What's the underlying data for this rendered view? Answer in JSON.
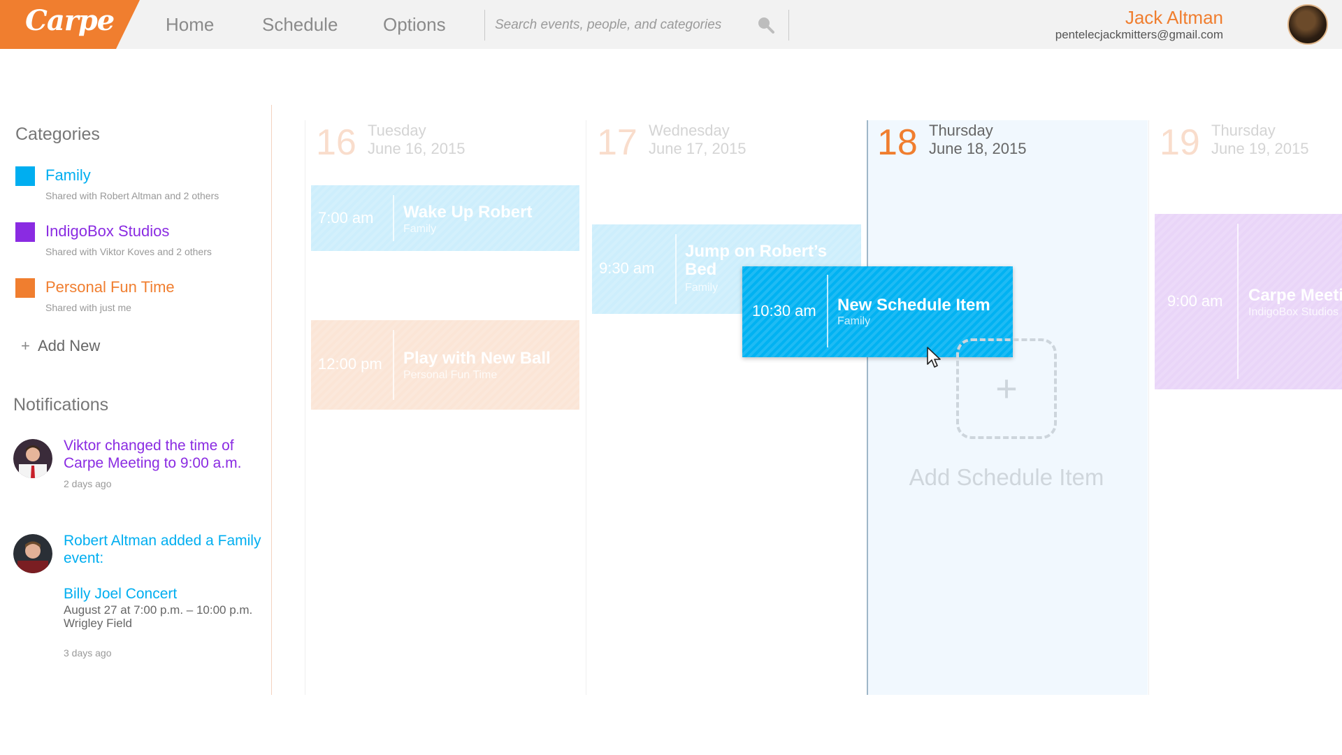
{
  "app": {
    "logo_text": "Carpe",
    "nav": [
      "Home",
      "Schedule",
      "Options"
    ],
    "search_placeholder": "Search events, people, and categories",
    "search_value": "",
    "user": {
      "name": "Jack Altman",
      "email": "pentelecjackmitters@gmail.com"
    }
  },
  "sidebar": {
    "categories_title": "Categories",
    "categories": [
      {
        "name": "Family",
        "shared": "Shared with Robert Altman and 2 others",
        "color": "#00aef0"
      },
      {
        "name": "IndigoBox Studios",
        "shared": "Shared with Viktor Koves and 2 others",
        "color": "#8a2be2"
      },
      {
        "name": "Personal Fun Time",
        "shared": "Shared with just me",
        "color": "#f07e2f"
      }
    ],
    "add_new_icon": "+",
    "add_new_label": "Add New",
    "notifications_title": "Notifications",
    "notifications": [
      {
        "text": "Viktor changed the time of Carpe Meeting to 9:00 a.m.",
        "time": "2 days ago",
        "color": "#8a2be2"
      },
      {
        "text": "Robert Altman added a Family event:",
        "event_title": "Billy Joel Concert",
        "event_when": "August 27 at 7:00 p.m. – 10:00 p.m.",
        "event_where": "Wrigley Field",
        "time": "3 days ago",
        "color": "#00aef0"
      }
    ]
  },
  "calendar": {
    "days": [
      {
        "num": "16",
        "name": "Tuesday",
        "date": "June 16, 2015"
      },
      {
        "num": "17",
        "name": "Wednesday",
        "date": "June 17, 2015"
      },
      {
        "num": "18",
        "name": "Thursday",
        "date": "June 18, 2015"
      },
      {
        "num": "19",
        "name": "Thursday",
        "date": "June 19, 2015"
      }
    ],
    "events": [
      {
        "time": "7:00 am",
        "title": "Wake Up Robert",
        "category": "Family"
      },
      {
        "time": "12:00 pm",
        "title": "Play with New Ball",
        "category": "Personal Fun Time"
      },
      {
        "time": "9:30 am",
        "title": "Jump on Robert’s Bed",
        "category": "Family"
      },
      {
        "time": "10:30 am",
        "title": "New Schedule Item",
        "category": "Family"
      },
      {
        "time": "9:00 am",
        "title": "Carpe Meeting",
        "category": "IndigoBox Studios"
      }
    ],
    "add_plus": "+",
    "add_label": "Add Schedule Item"
  },
  "colors": {
    "brand": "#f07e2f",
    "family": "#00aef0",
    "indigo": "#8a2be2",
    "personal": "#f07e2f",
    "today_bg": "#f1f8fe"
  }
}
